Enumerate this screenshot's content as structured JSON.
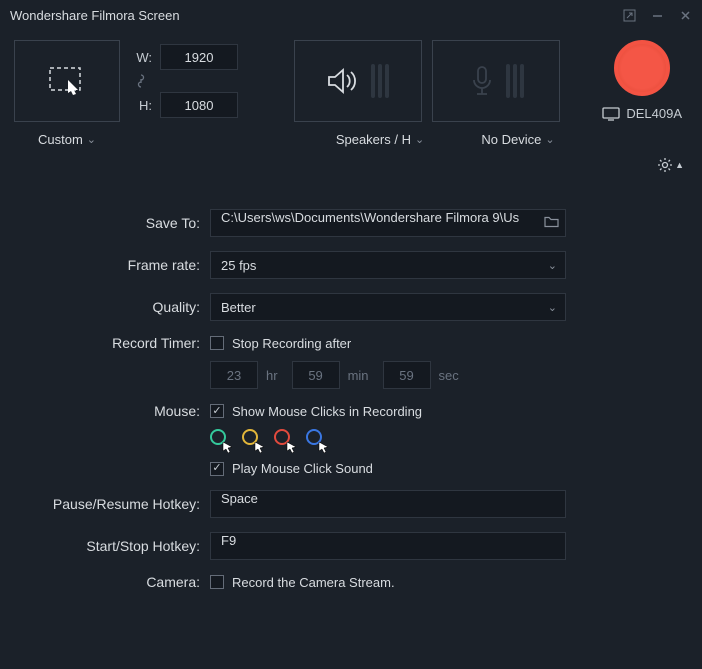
{
  "window": {
    "title": "Wondershare Filmora Screen"
  },
  "capture": {
    "mode_label": "Custom",
    "width_label": "W:",
    "height_label": "H:",
    "width": "1920",
    "height": "1080"
  },
  "audio": {
    "speaker_label": "Speakers / H",
    "mic_label": "No Device"
  },
  "display": {
    "name": "DEL409A"
  },
  "form": {
    "save_to": {
      "label": "Save To:",
      "value": "C:\\Users\\ws\\Documents\\Wondershare Filmora 9\\Us"
    },
    "frame_rate": {
      "label": "Frame rate:",
      "value": "25 fps"
    },
    "quality": {
      "label": "Quality:",
      "value": "Better"
    },
    "record_timer": {
      "label": "Record Timer:",
      "checkbox_label": "Stop Recording after",
      "hours": "23",
      "hours_unit": "hr",
      "minutes": "59",
      "minutes_unit": "min",
      "seconds": "59",
      "seconds_unit": "sec"
    },
    "mouse": {
      "label": "Mouse:",
      "show_clicks_label": "Show Mouse Clicks in Recording",
      "sound_label": "Play Mouse Click Sound"
    },
    "pause_hotkey": {
      "label": "Pause/Resume Hotkey:",
      "value": "Space"
    },
    "start_hotkey": {
      "label": "Start/Stop Hotkey:",
      "value": "F9"
    },
    "camera": {
      "label": "Camera:",
      "checkbox_label": "Record the Camera Stream."
    }
  },
  "cursor_colors": [
    "#34c99b",
    "#e2b63a",
    "#e24a3d",
    "#3a77e2"
  ]
}
